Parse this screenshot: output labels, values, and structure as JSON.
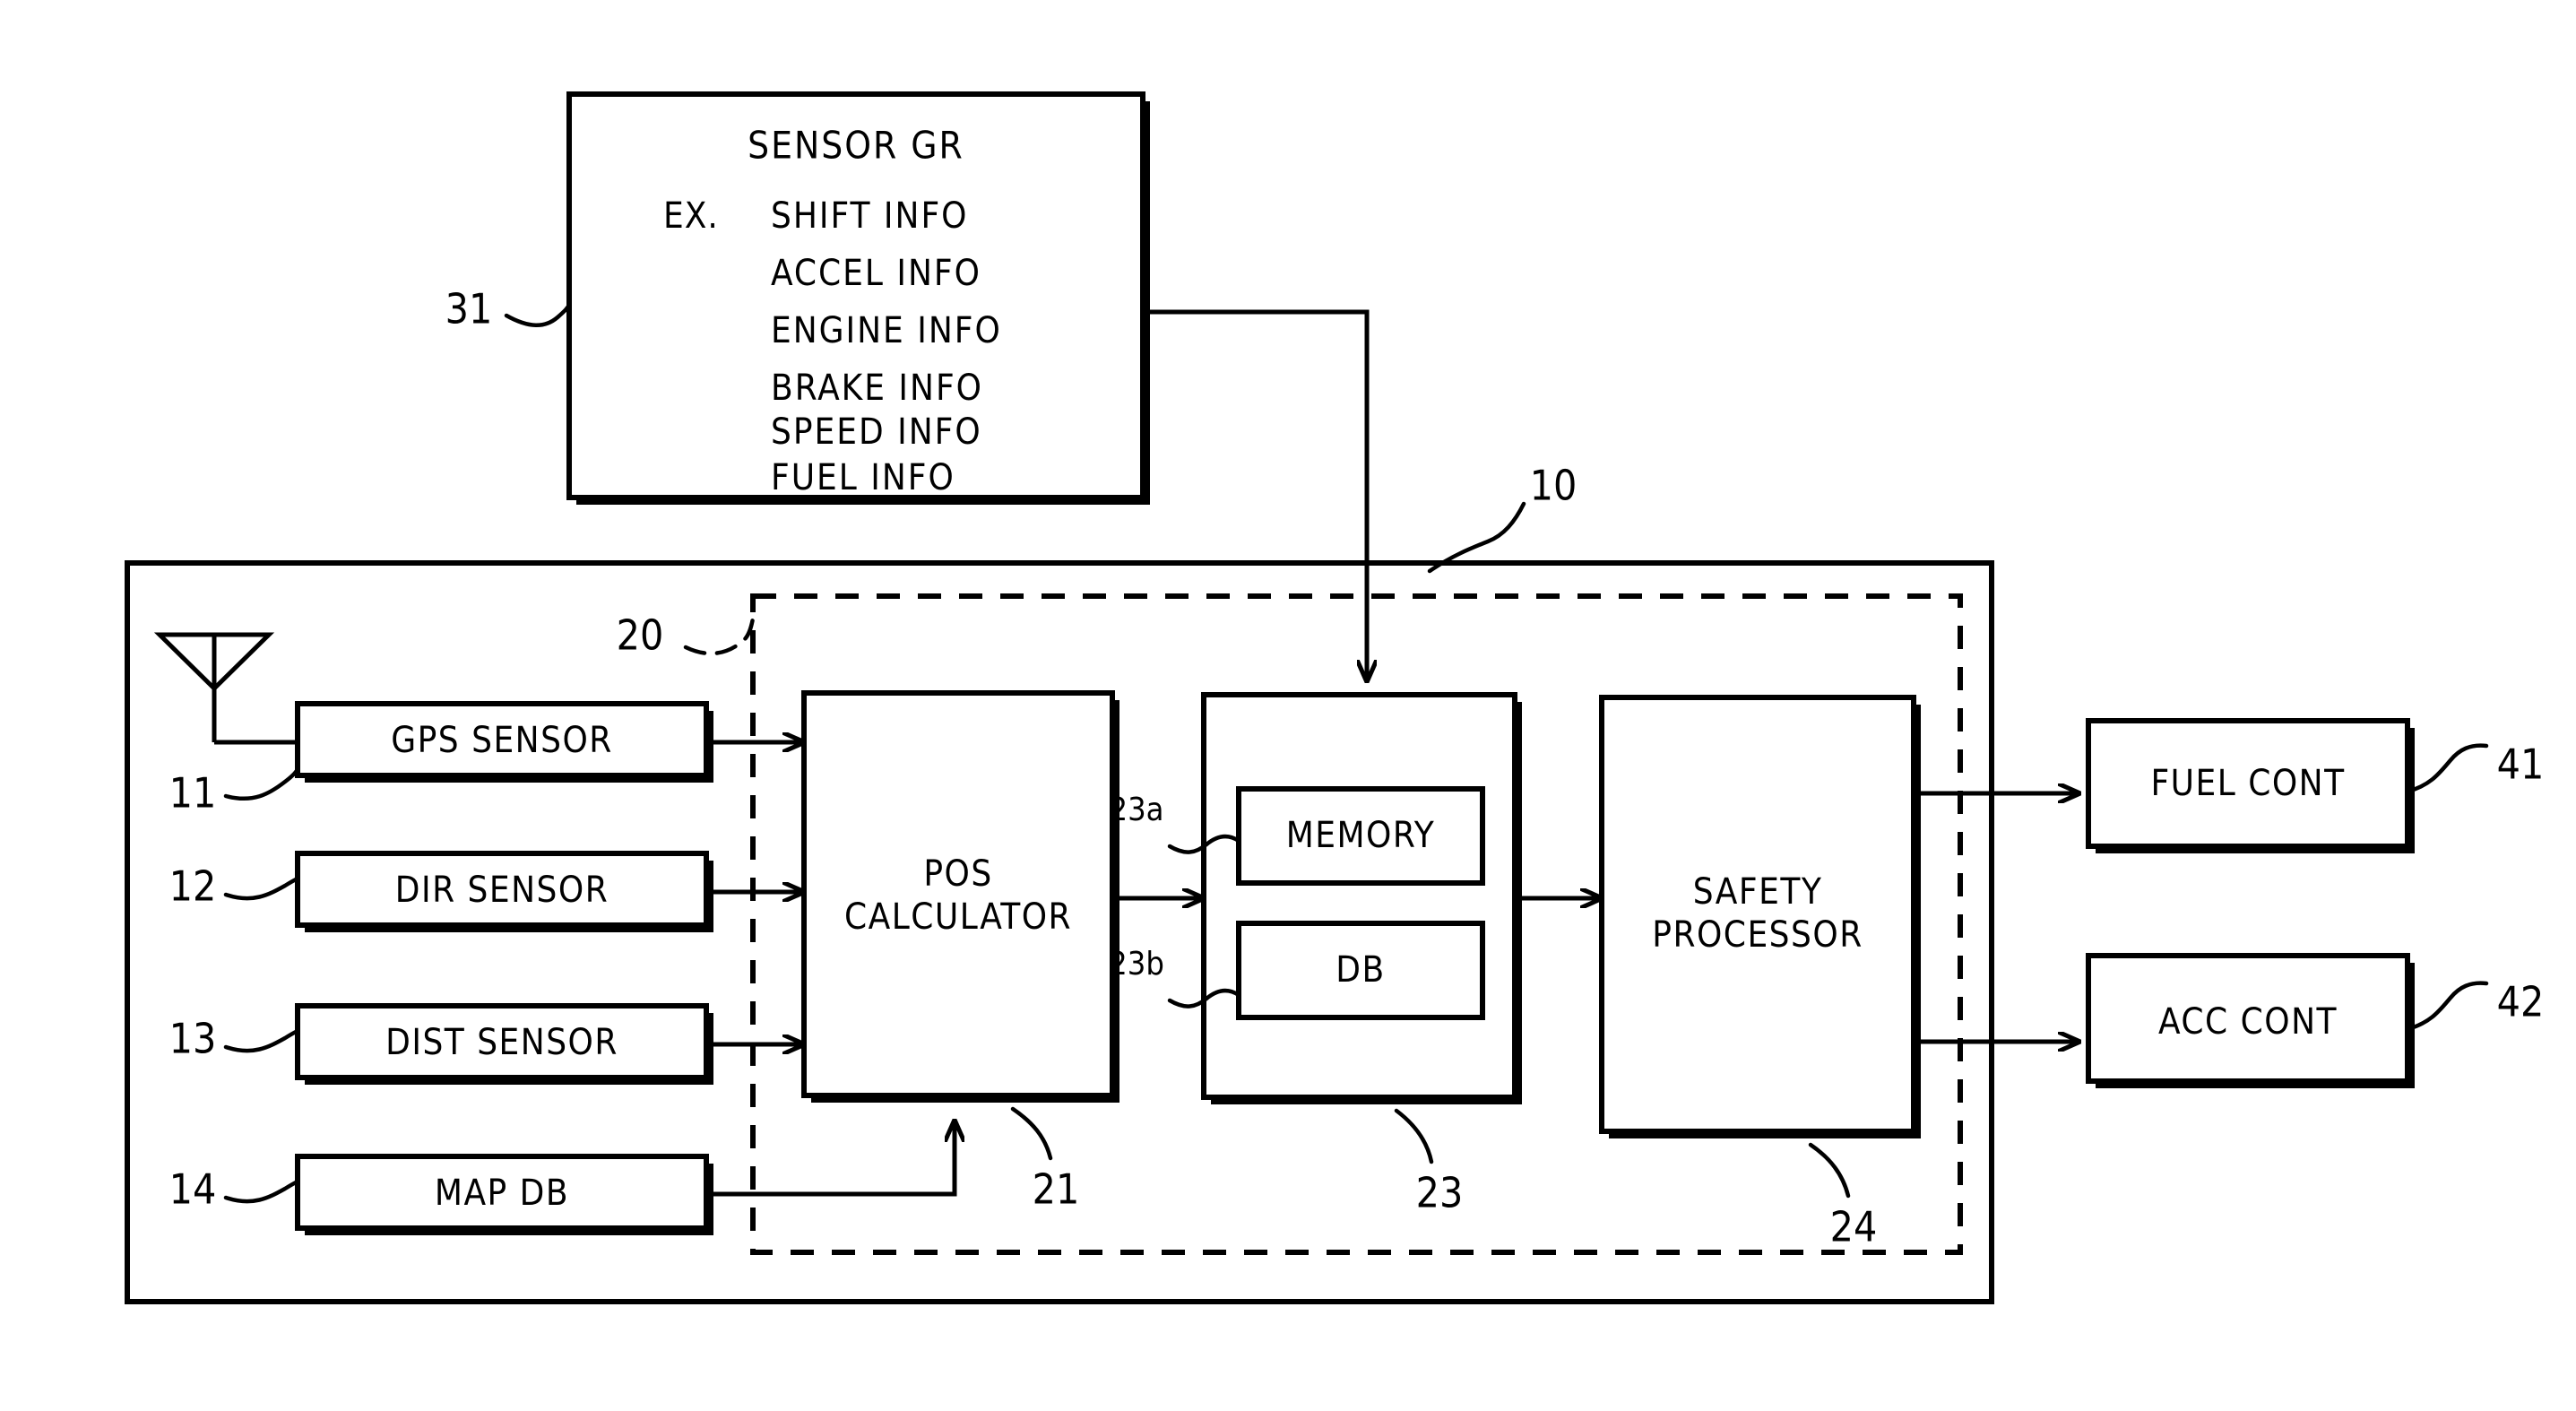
{
  "figure": {
    "kind": "patent-block-diagram",
    "background_color": "#ffffff",
    "line_color": "#000000"
  },
  "sensor_group": {
    "title": "SENSOR GR",
    "example_prefix": "EX.",
    "items": [
      "SHIFT INFO",
      "ACCEL INFO",
      "ENGINE INFO",
      "BRAKE INFO",
      "SPEED INFO",
      "FUEL INFO"
    ],
    "ref": "31"
  },
  "outer_unit": {
    "ref": "10"
  },
  "inner_unit": {
    "ref": "20"
  },
  "antenna": {
    "name": "antenna-symbol"
  },
  "inputs": [
    {
      "label": "GPS SENSOR",
      "ref": "11"
    },
    {
      "label": "DIR SENSOR",
      "ref": "12"
    },
    {
      "label": "DIST SENSOR",
      "ref": "13"
    },
    {
      "label": "MAP DB",
      "ref": "14"
    }
  ],
  "processing": {
    "pos_calculator": {
      "line1": "POS",
      "line2": "CALCULATOR",
      "ref": "21"
    },
    "storage": {
      "ref": "23",
      "memory": {
        "label": "MEMORY",
        "ref": "23a"
      },
      "db": {
        "label": "DB",
        "ref": "23b"
      }
    },
    "safety_processor": {
      "line1": "SAFETY",
      "line2": "PROCESSOR",
      "ref": "24"
    }
  },
  "outputs": [
    {
      "label": "FUEL CONT",
      "ref": "41"
    },
    {
      "label": "ACC CONT",
      "ref": "42"
    }
  ]
}
